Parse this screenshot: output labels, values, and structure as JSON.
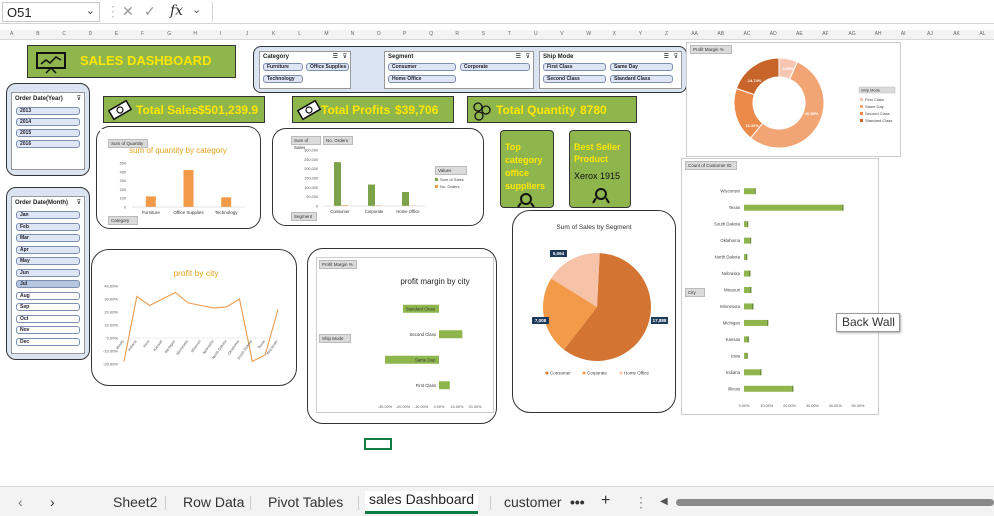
{
  "formula_bar": {
    "name_box": "O51",
    "fx": "fx"
  },
  "columns": [
    "A",
    "B",
    "C",
    "D",
    "E",
    "F",
    "G",
    "H",
    "I",
    "J",
    "K",
    "L",
    "M",
    "N",
    "O",
    "P",
    "Q",
    "R",
    "S",
    "T",
    "U",
    "V",
    "W",
    "X",
    "Y",
    "Z",
    "AA",
    "AB",
    "AC",
    "AD",
    "AE",
    "AF",
    "AG",
    "AH",
    "AI",
    "AJ",
    "AK",
    "AL"
  ],
  "dashboard": {
    "title": "SALES DASHBOARD",
    "kpis": {
      "total_sales_label": "Total Sales",
      "total_sales_value": "$501,239.9",
      "total_profits_label": "Total Profits",
      "total_profits_value": "$39,706",
      "total_quantity_label": "Total Quantity",
      "total_quantity_value": "8780"
    },
    "top_category": {
      "line1": "Top",
      "line2": "category",
      "line3": "office",
      "line4": "suppliers"
    },
    "best_seller": {
      "line1": "Best Seller",
      "line2": "Product",
      "value": "Xerox 1915"
    }
  },
  "slicers": {
    "category": {
      "title": "Category",
      "items": [
        "Furniture",
        "Office Supplies",
        "Technology"
      ]
    },
    "segment": {
      "title": "Segment",
      "items": [
        "Consumer",
        "Corporate",
        "Home Office"
      ]
    },
    "ship_mode": {
      "title": "Ship Mode",
      "items": [
        "First Class",
        "Same Day",
        "Second Class",
        "Standard Class"
      ]
    },
    "order_year": {
      "title": "Order Date(Year)",
      "items": [
        "2013",
        "2014",
        "2015",
        "2016"
      ]
    },
    "order_month": {
      "title": "Order Date(Month)",
      "items": [
        "Jan",
        "Feb",
        "Mar",
        "Apr",
        "May",
        "Jun",
        "Jul",
        "Aug",
        "Sep",
        "Oct",
        "Nov",
        "Dec"
      ]
    }
  },
  "charts": {
    "quantity": {
      "field_btn": "Sum of Quantity",
      "axis_btn": "Category",
      "title": "sum of quantity by category",
      "categories": [
        "Furniture",
        "Office Supplies",
        "Technology"
      ],
      "values": [
        120,
        420,
        110
      ],
      "ylim": [
        0,
        500
      ],
      "ticks": [
        "500",
        "400",
        "300",
        "200",
        "100",
        "0"
      ]
    },
    "segment_bar": {
      "field_btn1": "Sum of Sales",
      "field_btn2": "No. Orders",
      "axis_btn": "Segment",
      "legend_title": "Values",
      "legend": [
        "Sum of Sales",
        "No. Orders"
      ],
      "categories": [
        "Consumer",
        "Corporate",
        "Home Office"
      ],
      "sales": [
        235000,
        115000,
        75000
      ],
      "orders": [
        4000,
        2500,
        1800
      ],
      "ylim": [
        0,
        300000
      ],
      "ticks": [
        "300,000",
        "250,000",
        "200,000",
        "150,000",
        "100,000",
        "50,000",
        "0"
      ]
    },
    "profit_city": {
      "title": "profit by city",
      "ticks": [
        "40.00%",
        "30.00%",
        "20.00%",
        "10.00%",
        "0.00%",
        "-10.00%",
        "-20.00%"
      ],
      "cities": [
        "Illinois",
        "Indiana",
        "Iowa",
        "Kansas",
        "Michigan",
        "Minnesota",
        "Missouri",
        "Nebraska",
        "North Dakota",
        "Oklahoma",
        "South Dakota",
        "Texas",
        "Wisconsin"
      ],
      "values": [
        -18,
        32,
        25,
        30,
        35,
        27,
        25,
        23,
        24,
        30,
        -18,
        -13,
        22
      ],
      "ylim": [
        -20,
        40
      ]
    },
    "profit_margin": {
      "field_btn": "Profit Margin %",
      "axis_btn": "Ship Mode",
      "title": "profit margin by city",
      "categories": [
        "Standard Class",
        "Second Class",
        "Same Day",
        "First Class"
      ],
      "values": [
        -20,
        13,
        -30,
        6
      ],
      "xlim": [
        -40,
        30
      ],
      "ticks": [
        "-30.00%",
        "-20.00%",
        "-10.00%",
        "0.00%",
        "10.00%",
        "20.00%"
      ]
    },
    "sales_segment_pie": {
      "title": "Sum of Sales by Segment",
      "labels": [
        "Consumer",
        "Corporate",
        "Home Office"
      ],
      "values": [
        17888,
        7008,
        5064
      ],
      "data_labels": [
        "17,888",
        "7,008",
        "5,064"
      ],
      "colors": [
        "#d47432",
        "#f39a48",
        "#f6c2a8"
      ]
    },
    "donut": {
      "field_btn": "Profit Margin %",
      "legend_title": "Ship Mode",
      "legend": [
        "First Class",
        "Same Day",
        "Second Class",
        "Standard Class"
      ],
      "values": [
        5.0,
        40.5,
        14.5,
        14.8
      ],
      "data_labels": [
        "5.05%",
        "-40.55%",
        "13.43%",
        "-14.74%"
      ],
      "colors": [
        "#f6c6b3",
        "#f2a574",
        "#ec8a4a",
        "#c8652a"
      ]
    },
    "state_bar": {
      "field_btn": "Count of Customer ID",
      "axis_btn": "City",
      "categories": [
        "Wisconsin",
        "Texas",
        "South Dakota",
        "Oklahoma",
        "North Dakota",
        "Nebraska",
        "Missouri",
        "Minnesota",
        "Michigan",
        "Kansas",
        "Iowa",
        "Indiana",
        "Illinois"
      ],
      "values": [
        4.5,
        43,
        1.2,
        2.5,
        0.8,
        2.2,
        2.6,
        3.5,
        10,
        1.5,
        1.0,
        7,
        21
      ],
      "xlim": [
        0,
        50
      ],
      "ticks": [
        "0.00%",
        "10.00%",
        "20.00%",
        "30.00%",
        "40.00%",
        "50.00%"
      ]
    }
  },
  "tooltip": "Back Wall",
  "sheet_tabs": [
    "Sheet2",
    "Row Data",
    "Pivot Tables",
    "sales Dashboard",
    "customer"
  ],
  "active_tab": "sales Dashboard"
}
